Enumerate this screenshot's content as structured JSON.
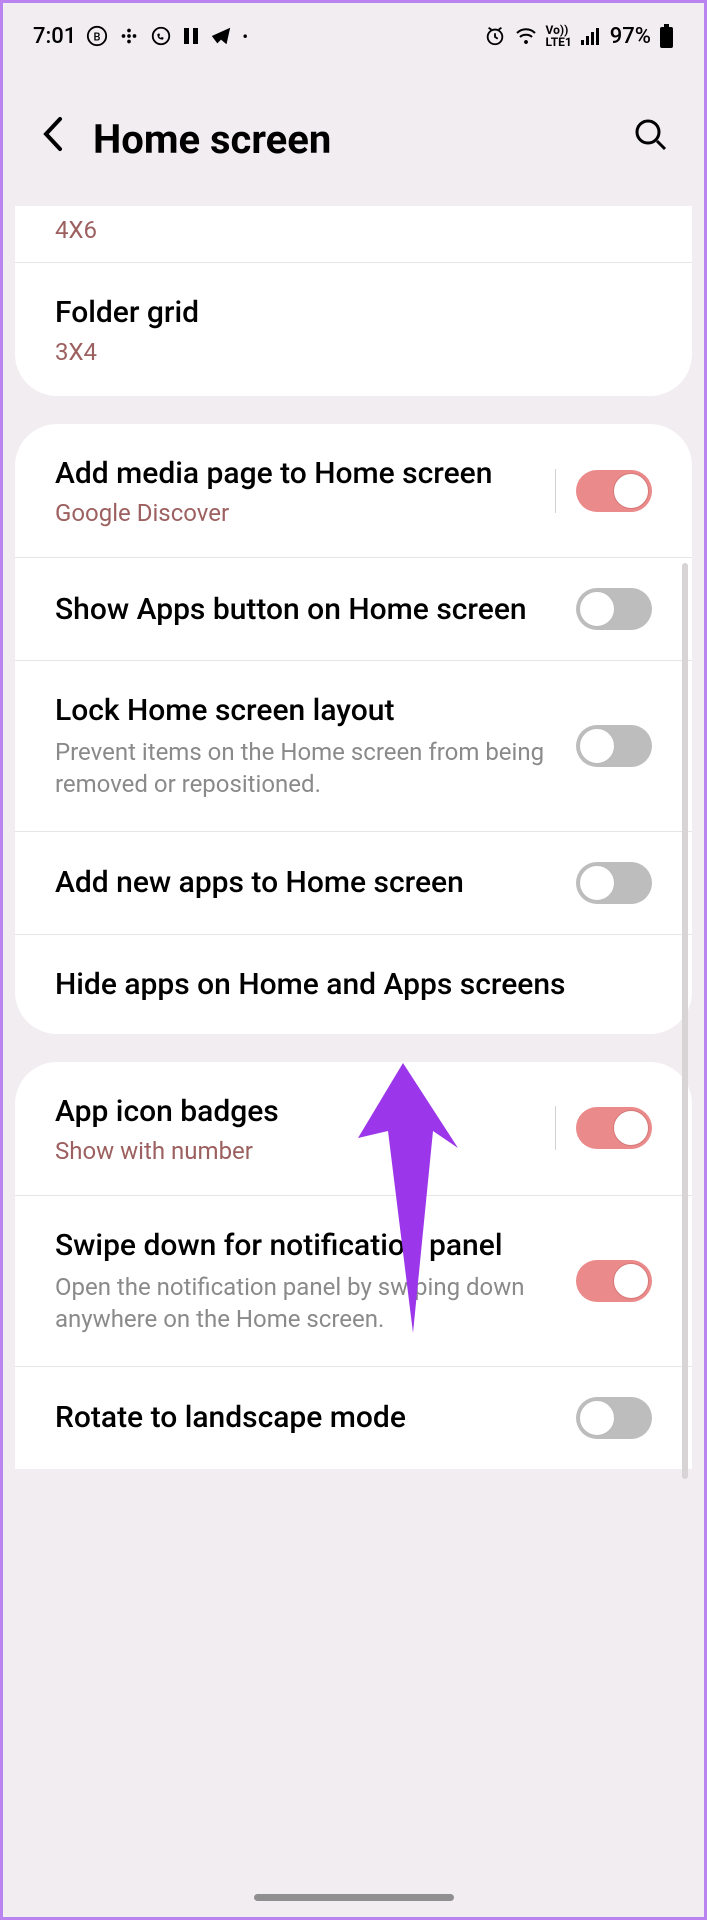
{
  "status": {
    "time": "7:01",
    "battery": "97%"
  },
  "header": {
    "title": "Home screen"
  },
  "section1": {
    "partial_value": "4X6",
    "folder_grid_title": "Folder grid",
    "folder_grid_value": "3X4"
  },
  "section2": {
    "media_page_title": "Add media page to Home screen",
    "media_page_sub": "Google Discover",
    "show_apps_title": "Show Apps button on Home screen",
    "lock_layout_title": "Lock Home screen layout",
    "lock_layout_desc": "Prevent items on the Home screen from being removed or repositioned.",
    "add_new_apps_title": "Add new apps to Home screen",
    "hide_apps_title": "Hide apps on Home and Apps screens"
  },
  "section3": {
    "badges_title": "App icon badges",
    "badges_sub": "Show with number",
    "swipe_title": "Swipe down for notification panel",
    "swipe_desc": "Open the notification panel by swiping down anywhere on the Home screen.",
    "rotate_title": "Rotate to landscape mode"
  }
}
